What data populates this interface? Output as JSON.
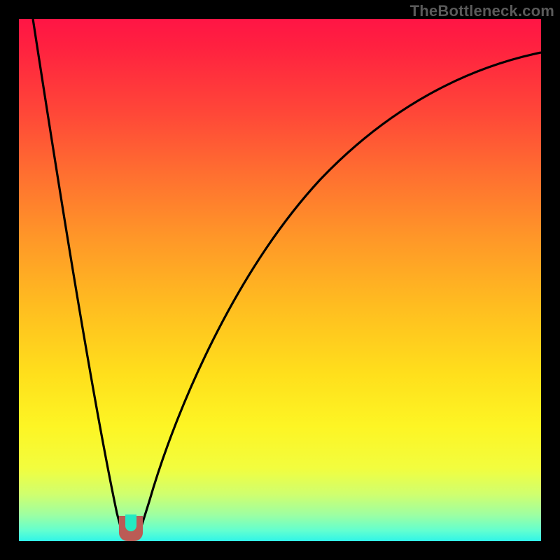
{
  "attribution": "TheBottleneck.com",
  "colors": {
    "page_bg": "#000000",
    "curve_stroke": "#000000",
    "nub_fill": "#bb5b55",
    "nub_inner": "#24e9c2",
    "attribution_text": "#5a5a5a"
  },
  "chart_data": {
    "type": "line",
    "title": "",
    "xlabel": "",
    "ylabel": "",
    "xlim": [
      0,
      100
    ],
    "ylim": [
      0,
      100
    ],
    "grid": false,
    "legend": false,
    "note": "Axes are unlabeled in the source image; x and y are normalized 0–100. The two curves form a V/funnel that meets near x≈19, y≈0 where a small colored nub sits.",
    "series": [
      {
        "name": "left-curve",
        "x": [
          0,
          2,
          4,
          6,
          8,
          10,
          12,
          14,
          16,
          17,
          18,
          19
        ],
        "y": [
          100,
          90,
          80,
          69,
          58,
          47,
          36,
          25,
          14,
          9,
          4,
          0
        ]
      },
      {
        "name": "right-curve",
        "x": [
          21,
          23,
          25,
          28,
          32,
          37,
          43,
          50,
          58,
          67,
          77,
          88,
          100
        ],
        "y": [
          0,
          8,
          15,
          24,
          34,
          44,
          54,
          63,
          71,
          78,
          84,
          89,
          93
        ]
      }
    ],
    "marker": {
      "name": "bottleneck-nub",
      "x": 19,
      "y": 0,
      "shape": "rounded-u",
      "fill": "#bb5b55",
      "inner_fill": "#24e9c2"
    }
  }
}
